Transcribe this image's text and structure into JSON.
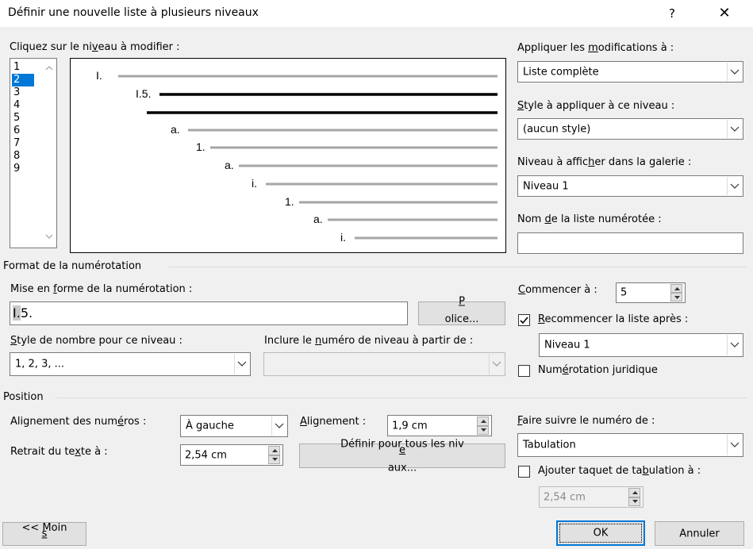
{
  "window": {
    "title": "Définir une nouvelle liste à plusieurs niveaux",
    "help": "?",
    "close": "✕"
  },
  "levels": {
    "label": "Cliquez sur le niveau à modifier :",
    "items": [
      "1",
      "2",
      "3",
      "4",
      "5",
      "6",
      "7",
      "8",
      "9"
    ],
    "selected": "2"
  },
  "preview": {
    "rows": [
      {
        "label": "I.",
        "bold": false
      },
      {
        "label": "I.5.",
        "bold": true
      },
      {
        "label": "",
        "bold": true
      },
      {
        "label": "a.",
        "bold": false
      },
      {
        "label": "1.",
        "bold": false
      },
      {
        "label": "a.",
        "bold": false
      },
      {
        "label": "i.",
        "bold": false
      },
      {
        "label": "1.",
        "bold": false
      },
      {
        "label": "a.",
        "bold": false
      },
      {
        "label": "i.",
        "bold": false
      }
    ]
  },
  "right": {
    "apply_label": "Appliquer les modifications à :",
    "apply_value": "Liste complète",
    "style_label": "Style à appliquer à ce niveau :",
    "style_value": "(aucun style)",
    "gallery_label": "Niveau à afficher dans la galerie :",
    "gallery_value": "Niveau 1",
    "listname_label": "Nom de la liste numérotée :",
    "listname_value": ""
  },
  "format": {
    "section": "Format de la numérotation",
    "mise_label": "Mise en forme de la numérotation :",
    "mise_value_prefix": "I.",
    "mise_value_rest": "5.",
    "police_button": "Police...",
    "style_label": "Style de nombre pour ce niveau :",
    "style_value": "1, 2, 3, ...",
    "include_label": "Inclure le numéro de niveau à partir de :",
    "include_value": "",
    "start_label": "Commencer à :",
    "start_value": "5",
    "restart_label": "Recommencer la liste après :",
    "restart_checked": true,
    "restart_value": "Niveau 1",
    "legal_label": "Numérotation juridique",
    "legal_checked": false
  },
  "position": {
    "section": "Position",
    "align_numbers_label": "Alignement des numéros :",
    "align_numbers_value": "À gauche",
    "alignment_label": "Alignement :",
    "alignment_value": "1,9 cm",
    "indent_label": "Retrait du texte à :",
    "indent_value": "2,54 cm",
    "set_all_button": "Définir pour tous les niveaux...",
    "follow_label": "Faire suivre le numéro de :",
    "follow_value": "Tabulation",
    "tabstop_label": "Ajouter taquet de tabulation à :",
    "tabstop_checked": false,
    "tabstop_value": "2,54 cm"
  },
  "footer": {
    "less_button": "<< Moins",
    "ok_button": "OK",
    "cancel_button": "Annuler"
  },
  "colors": {
    "accent": "#0078d7",
    "preview_line_gray": "#a6a6a6",
    "preview_line_bold": "#000000"
  }
}
